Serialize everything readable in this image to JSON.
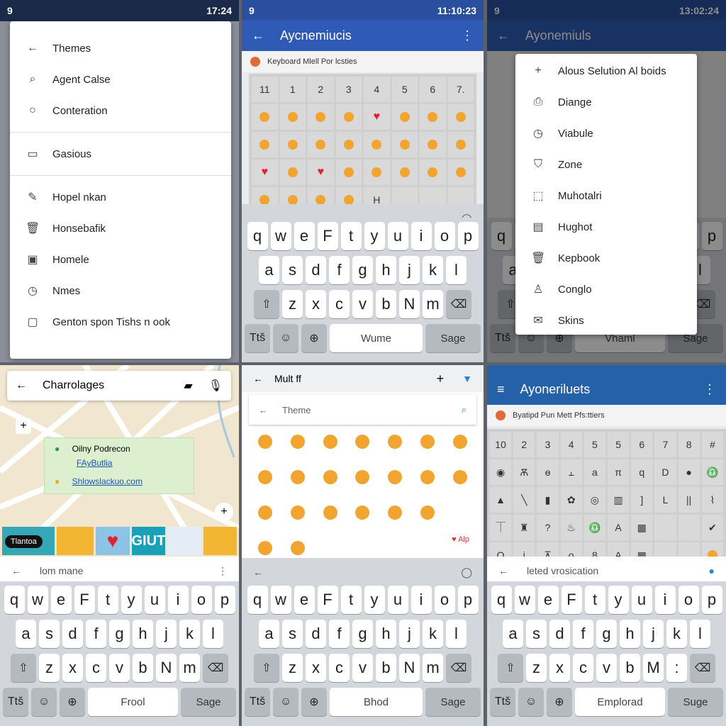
{
  "colors": {
    "blue": "#2f5bb7",
    "blue2": "#2561a8",
    "status_dark": "#1c2a4a",
    "map": "#f1e6cf"
  },
  "panel1": {
    "status": {
      "left": "9",
      "time": "17:24"
    },
    "menu": [
      {
        "icon": "←",
        "label": "Themes"
      },
      {
        "icon": "⌕",
        "label": "Agent Calse"
      },
      {
        "icon": "○",
        "label": "Conteration"
      },
      {
        "sep": true
      },
      {
        "icon": "▭",
        "label": "Gasious"
      },
      {
        "sep": true
      },
      {
        "icon": "✎",
        "label": "Hopel nkan"
      },
      {
        "icon": "🗑",
        "label": "Honsebafik"
      },
      {
        "icon": "▣",
        "label": "Homele"
      },
      {
        "icon": "◷",
        "label": "Nmes"
      },
      {
        "icon": "▢",
        "label": "Genton spon Tishs n ook"
      }
    ]
  },
  "panel2": {
    "status": {
      "left": "9",
      "time": "11:10:23"
    },
    "title": "Aycnemiucis",
    "subtitle": "Keyboard Mlell Por lcsties",
    "grid_header": [
      "11",
      "1",
      "2",
      "3",
      "4",
      "5",
      "6",
      "7."
    ],
    "grid": [
      [
        "face",
        "face",
        "face",
        "face",
        "heart",
        "face",
        "face",
        "face"
      ],
      [
        "face",
        "face",
        "face",
        "face",
        "face",
        "face",
        "face",
        "face"
      ],
      [
        "heart",
        "face",
        "heart",
        "face",
        "face",
        "face",
        "face",
        "face"
      ],
      [
        "face",
        "face",
        "face",
        "face",
        "H",
        "",
        "",
        ""
      ]
    ],
    "keyboard": {
      "rows": [
        "qweFtyuiop",
        "asdfghjkl",
        "zxcvbNm"
      ],
      "bottom": [
        "Ttš",
        "Wume",
        "Sage"
      ]
    }
  },
  "panel3": {
    "status": {
      "left": "9",
      "time": "13:02:24"
    },
    "title": "Ayonemiuls",
    "menu": [
      {
        "icon": "+",
        "label": "Alous Selution Al boids"
      },
      {
        "icon": "⎙",
        "label": "Diange"
      },
      {
        "icon": "◷",
        "label": "Viabule"
      },
      {
        "icon": "⛉",
        "label": "Zone"
      },
      {
        "icon": "⬚",
        "label": "Muhotalri"
      },
      {
        "icon": "▤",
        "label": "Hughot"
      },
      {
        "icon": "🗑",
        "label": "Kepbook"
      },
      {
        "icon": "♙",
        "label": "Conglo"
      },
      {
        "icon": "✉",
        "label": "Skins"
      }
    ],
    "keyboard": {
      "rows": [
        "qweFtyuiop",
        "asdfghjkl",
        "zxcvbNm"
      ],
      "bottom": [
        "Ttš",
        "Vhaml",
        "Sage"
      ]
    }
  },
  "panel4": {
    "search": "Charrolages",
    "card": {
      "title": "Oilny Podrecon",
      "link1": "FAyButlia",
      "link2": "Shlowslackuo.com"
    },
    "sticker_label": "Tlantoa",
    "sticker_text": "GIUT",
    "toolbar": "lom mane",
    "keyboard": {
      "rows": [
        "qweFtyuiop",
        "asdfghjkl",
        "zxcvbNm"
      ],
      "bottom": [
        "Ttš",
        "Frool",
        "Sage"
      ]
    }
  },
  "panel5": {
    "title": "Mult ff",
    "search": "Theme",
    "grid": [
      [
        "face",
        "face",
        "face",
        "face",
        "face",
        "face",
        "face"
      ],
      [
        "face",
        "face",
        "face",
        "face",
        "face",
        "face",
        "face"
      ],
      [
        "face",
        "face",
        "face",
        "face",
        "face",
        "face",
        ""
      ],
      [
        "face",
        "face",
        "",
        "",
        "",
        "",
        ""
      ]
    ],
    "badge": "Alp",
    "keyboard": {
      "rows": [
        "qweFtyuiop",
        "asdfghjkl",
        "zxcvbNm"
      ],
      "bottom": [
        "Ttš",
        "Bhod",
        "Sage"
      ]
    }
  },
  "panel6": {
    "title": "Ayoneriluets",
    "subtitle": "Byatipd Pun Mett Pfs:ttiers",
    "grid_header": [
      "10",
      "2",
      "3",
      "4",
      "5",
      "5",
      "6",
      "7",
      "8",
      "#"
    ],
    "grid": [
      [
        "◉",
        "Ѫ",
        "ɵ",
        "⫠",
        "a",
        "π",
        "q",
        "D",
        "●",
        "♎"
      ],
      [
        "▲",
        "╲",
        "▮",
        "✿",
        "◎",
        "▥",
        "]",
        "L",
        "||",
        "⌇"
      ],
      [
        "⏉",
        "♜",
        "?",
        "♨",
        "♎",
        "A",
        "▦",
        "",
        "",
        "✔"
      ],
      [
        "Q",
        "i",
        "⊼",
        "o",
        "8",
        "A",
        "▦",
        "",
        "",
        "face"
      ]
    ],
    "toolbar": "leted vrosication",
    "keyboard": {
      "rows": [
        "qweFtyuiop",
        "asdfghjkl",
        "zxcvbM:"
      ],
      "bottom": [
        "Ttš",
        "Emplorad",
        "Suge"
      ]
    }
  }
}
